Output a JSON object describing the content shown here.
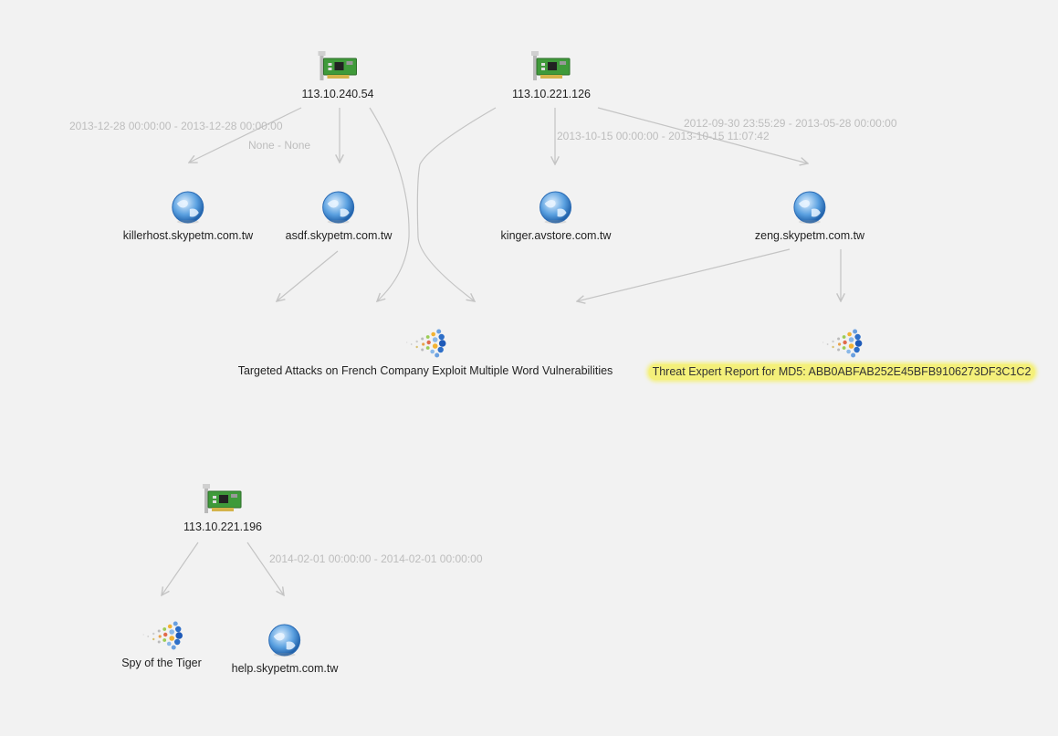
{
  "graph": {
    "nodes": {
      "ip_113_10_240_54": {
        "label": "113.10.240.54",
        "icon": "network-card-icon"
      },
      "ip_113_10_221_126": {
        "label": "113.10.221.126",
        "icon": "network-card-icon"
      },
      "ip_113_10_221_196": {
        "label": "113.10.221.196",
        "icon": "network-card-icon"
      },
      "host_killerhost": {
        "label": "killerhost.skypetm.com.tw",
        "icon": "globe-icon"
      },
      "host_asdf": {
        "label": "asdf.skypetm.com.tw",
        "icon": "globe-icon"
      },
      "host_kinger": {
        "label": "kinger.avstore.com.tw",
        "icon": "globe-icon"
      },
      "host_zeng": {
        "label": "zeng.skypetm.com.tw",
        "icon": "globe-icon"
      },
      "host_help": {
        "label": "help.skypetm.com.tw",
        "icon": "globe-icon"
      },
      "report_targeted": {
        "label": "Targeted Attacks on French Company Exploit Multiple Word Vulnerabilities",
        "icon": "dot-burst-icon"
      },
      "report_threat_expert": {
        "label": "Threat Expert Report for MD5: ABB0ABFAB252E45BFB9106273DF3C1C2",
        "icon": "dot-burst-icon",
        "highlight_color": "#f4f07a"
      },
      "report_spy_tiger": {
        "label": "Spy of the Tiger",
        "icon": "dot-burst-icon"
      }
    },
    "edge_labels": {
      "ip240_killerhost": "2013-12-28 00:00:00 - 2013-12-28 00:00:00",
      "ip240_asdf": "None - None",
      "ip126_zeng": "2012-09-30 23:55:29 - 2013-05-28 00:00:00",
      "ip126_kinger": "2013-10-15 00:00:00 - 2013-10-15 11:07:42",
      "ip196_help": "2014-02-01 00:00:00 - 2014-02-01 00:00:00"
    },
    "edge_color": "#c4c4c4"
  }
}
